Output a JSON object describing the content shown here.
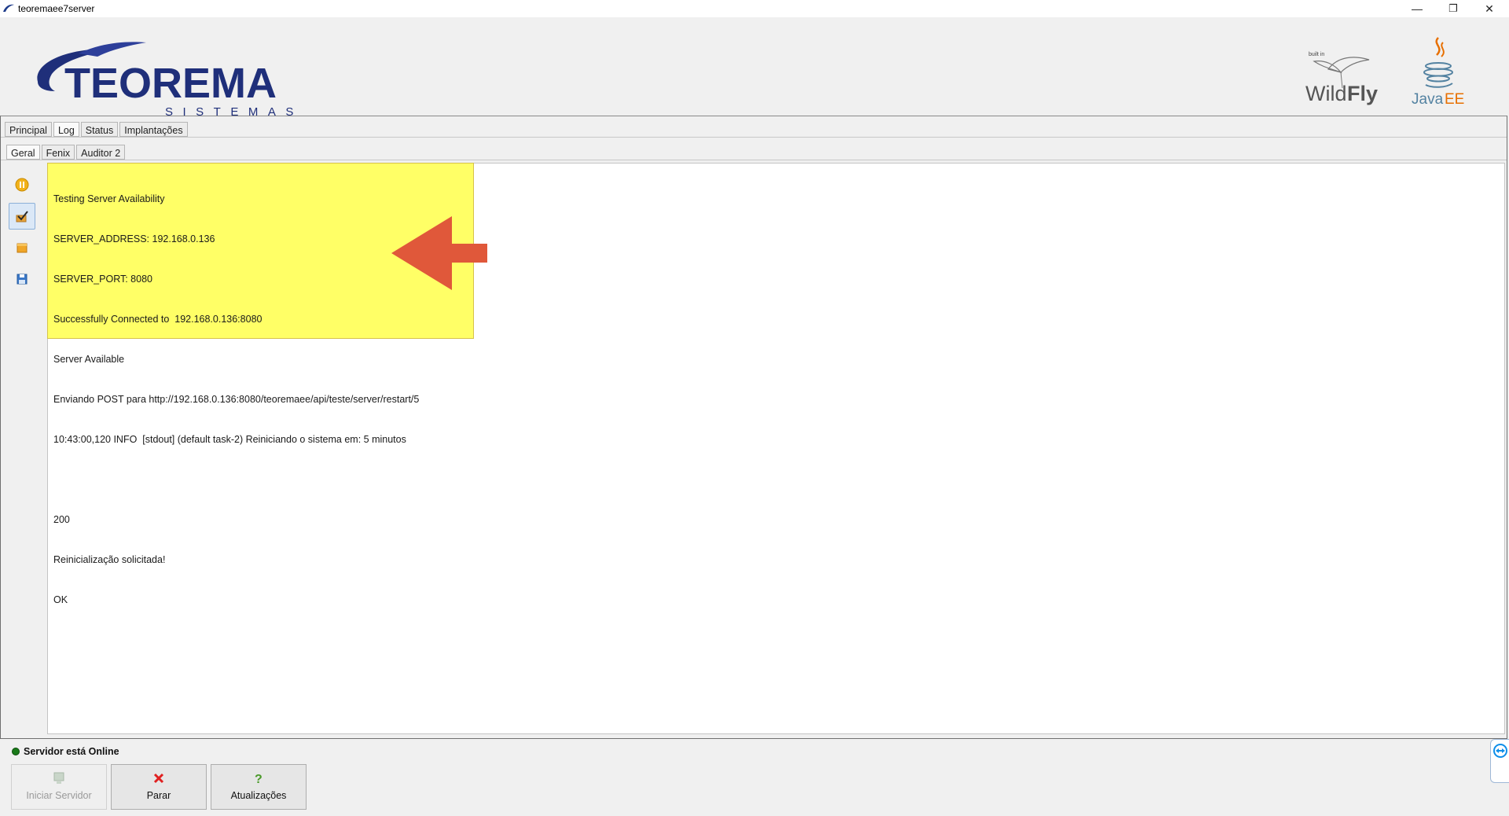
{
  "window": {
    "title": "teoremaee7server",
    "controls": {
      "minimize": "—",
      "restore": "❐",
      "close": "✕"
    }
  },
  "header": {
    "logo_main": "TEOREMA",
    "logo_sub": "SISTEMAS",
    "wildfly": {
      "built_in": "built in",
      "name_light": "Wild",
      "name_bold": "Fly"
    },
    "javaee": {
      "java": "Java",
      "ee": "EE"
    }
  },
  "tabs": {
    "top": [
      {
        "label": "Principal",
        "active": false
      },
      {
        "label": "Log",
        "active": true
      },
      {
        "label": "Status",
        "active": false
      },
      {
        "label": "Implantações",
        "active": false
      }
    ],
    "sub": [
      {
        "label": "Geral",
        "active": true
      },
      {
        "label": "Fenix",
        "active": false
      },
      {
        "label": "Auditor 2",
        "active": false
      }
    ]
  },
  "toolbar": {
    "buttons": [
      {
        "icon": "pause-icon",
        "pressed": false
      },
      {
        "icon": "check-icon",
        "pressed": true
      },
      {
        "icon": "clear-icon",
        "pressed": false
      },
      {
        "icon": "save-icon",
        "pressed": false
      }
    ]
  },
  "log": {
    "lines": [
      "Testing Server Availability",
      "SERVER_ADDRESS: 192.168.0.136",
      "SERVER_PORT: 8080",
      "Successfully Connected to  192.168.0.136:8080",
      "Server Available",
      "Enviando POST para http://192.168.0.136:8080/teoremaee/api/teste/server/restart/5",
      "10:43:00,120 INFO  [stdout] (default task-2) Reiniciando o sistema em: 5 minutos",
      "",
      "200",
      "Reinicialização solicitada!",
      "OK"
    ],
    "highlight_color": "#ffff66",
    "arrow_color": "#e0583a"
  },
  "status": {
    "text": "Servidor está Online",
    "color": "#1a7a1a"
  },
  "actions": {
    "start": {
      "label": "Iniciar Servidor",
      "enabled": false
    },
    "stop": {
      "label": "Parar",
      "enabled": true
    },
    "updates": {
      "label": "Atualizações",
      "enabled": true
    }
  }
}
